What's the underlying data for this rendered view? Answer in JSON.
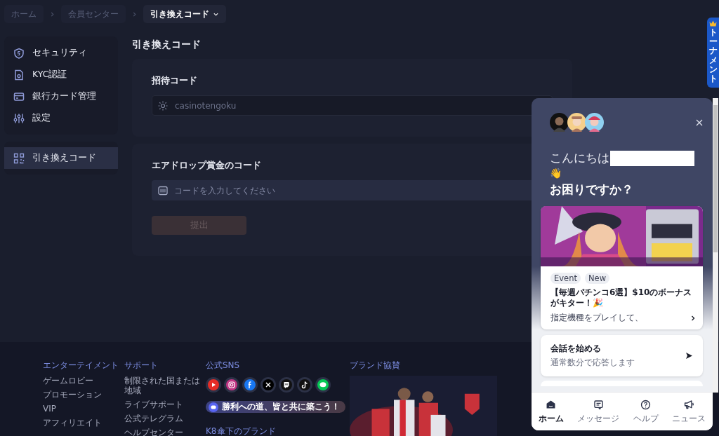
{
  "breadcrumb": [
    {
      "label": "ホーム",
      "selected": false
    },
    {
      "label": "会員センター",
      "selected": false
    },
    {
      "label": "引き換えコード",
      "selected": true
    }
  ],
  "sidebar": {
    "groups": [
      [
        {
          "label": "セキュリティ",
          "kind": "shield",
          "selected": false
        },
        {
          "label": "KYC認証",
          "kind": "document",
          "selected": false
        },
        {
          "label": "銀行カード管理",
          "kind": "card",
          "selected": false
        },
        {
          "label": "設定",
          "kind": "sliders",
          "selected": false
        }
      ],
      [
        {
          "label": "引き換えコード",
          "kind": "qr",
          "selected": true
        }
      ]
    ]
  },
  "page_title": "引き換えコード",
  "invite_section": {
    "label": "招待コード",
    "value": "casinotengoku",
    "disabled": true
  },
  "airdrop_section": {
    "label": "エアドロップ賞金のコード",
    "placeholder": "コードを入力してください",
    "button": {
      "label": "提出",
      "disabled": true
    }
  },
  "footer": {
    "columns": [
      {
        "heading": "エンターテイメント",
        "links": [
          "ゲームロビー",
          "プロモーション",
          "VIP",
          "アフィリエイト"
        ]
      },
      {
        "heading": "サポート",
        "links": [
          "制限された国または地域",
          "ライブサポート",
          "公式テレグラム",
          "ヘルプセンター"
        ]
      }
    ],
    "sns_heading": "公式SNS",
    "community_button": "勝利への道、皆と共に築こう！",
    "brands_heading": "K8傘下のブランド",
    "sponsor_heading": "ブランド協賛",
    "sponsor_media": {
      "kind": "picture"
    }
  },
  "tournament_tab": {
    "label": "トーナメント"
  },
  "chat": {
    "greeting": "こんにちは",
    "wave": "👋",
    "question": "お困りですか？",
    "news_card": {
      "media": {
        "kind": "picture"
      },
      "tags": [
        "Event",
        "New"
      ],
      "title": "【毎週パチンコ6選】$10のボーナスがキター！🎉",
      "subtitle": "指定機種をプレイして、"
    },
    "start_card": {
      "title": "会話を始める",
      "subtitle": "通常数分で応答します"
    },
    "nav": [
      {
        "label": "ホーム",
        "selected": true
      },
      {
        "label": "メッセージ",
        "selected": false
      },
      {
        "label": "ヘルプ",
        "selected": false
      },
      {
        "label": "ニュース",
        "selected": false
      }
    ]
  }
}
